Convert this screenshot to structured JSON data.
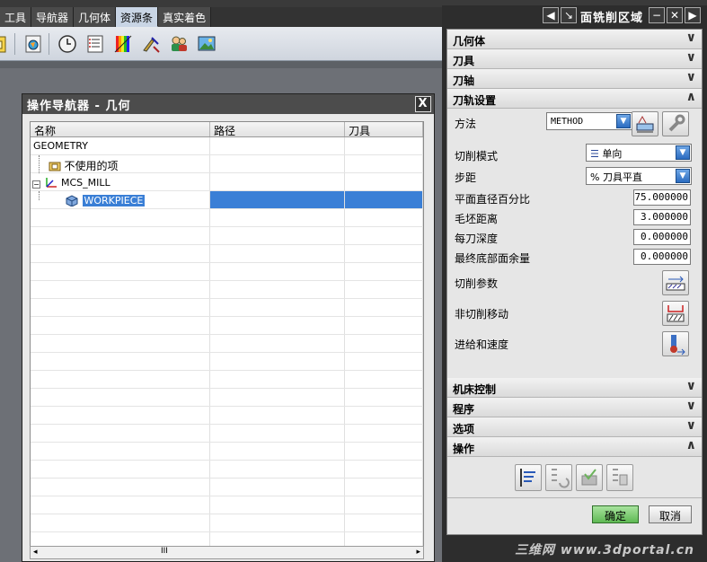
{
  "menu": {
    "tabs": [
      "工具",
      "导航器",
      "几何体",
      "资源条",
      "真实着色"
    ],
    "active_index": 3
  },
  "toolbar": {
    "icons": [
      "program-icon",
      "render-icon",
      "clock-icon",
      "list-icon",
      "color-icon",
      "tool-icon",
      "users-icon",
      "image-icon"
    ]
  },
  "navigator": {
    "title": "操作导航器 - 几何",
    "close": "X",
    "columns": [
      "名称",
      "路径",
      "刀具"
    ],
    "rows": [
      {
        "name": "GEOMETRY",
        "indent": 0
      },
      {
        "name": "不使用的项",
        "indent": 1
      },
      {
        "name": "MCS_MILL",
        "indent": 1
      },
      {
        "name": "WORKPIECE",
        "indent": 2,
        "selected": true
      }
    ],
    "scroll_grip": "III",
    "scroll_left": "◂",
    "scroll_right": "▸"
  },
  "dialog": {
    "title": "面铣削区域",
    "sections": {
      "geometry": "几何体",
      "tool": "刀具",
      "axis": "刀轴",
      "path_settings": "刀轨设置",
      "machine_control": "机床控制",
      "program": "程序",
      "options": "选项",
      "actions": "操作"
    },
    "path": {
      "method_label": "方法",
      "method_value": "METHOD",
      "cut_mode_label": "切削模式",
      "cut_mode_value": "单向",
      "stepover_label": "步距",
      "stepover_value": "% 刀具平直",
      "flat_pct_label": "平面直径百分比",
      "flat_pct_value": "75.000000",
      "blank_dist_label": "毛坯距离",
      "blank_dist_value": "3.000000",
      "depth_per_cut_label": "每刀深度",
      "depth_per_cut_value": "0.000000",
      "final_floor_label": "最终底部面余量",
      "final_floor_value": "0.000000",
      "cut_params_label": "切削参数",
      "non_cut_label": "非切削移动",
      "feeds_label": "进给和速度"
    },
    "ok": "确定",
    "cancel": "取消"
  },
  "watermark": "三维网 www.3dportal.cn",
  "colors": {
    "selection": "#3a7fd6",
    "ok_button": "#5fb954",
    "combo_arrow": "#2b6cc0"
  }
}
